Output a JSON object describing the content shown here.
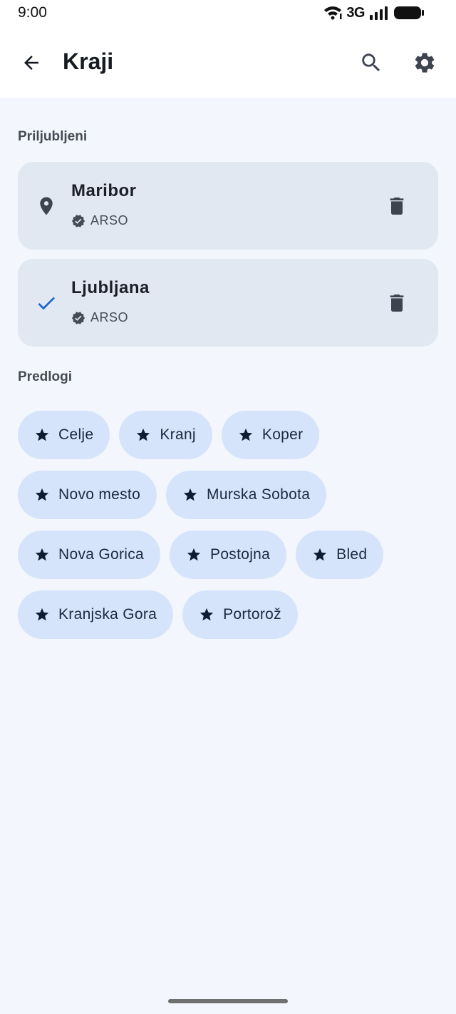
{
  "status": {
    "time": "9:00",
    "network": "3G"
  },
  "appbar": {
    "title": "Kraji"
  },
  "favorites": {
    "title": "Priljubljeni",
    "items": [
      {
        "name": "Maribor",
        "source": "ARSO",
        "lead_icon": "location-pin-icon"
      },
      {
        "name": "Ljubljana",
        "source": "ARSO",
        "lead_icon": "check-icon"
      }
    ]
  },
  "suggestions": {
    "title": "Predlogi",
    "chips": [
      "Celje",
      "Kranj",
      "Koper",
      "Novo mesto",
      "Murska Sobota",
      "Nova Gorica",
      "Postojna",
      "Bled",
      "Kranjska Gora",
      "Portorož"
    ]
  },
  "colors": {
    "accent": "#1a66cc",
    "chip_bg": "#d5e4fa",
    "card_bg": "#e1e8f2",
    "background": "#f3f6fc"
  }
}
